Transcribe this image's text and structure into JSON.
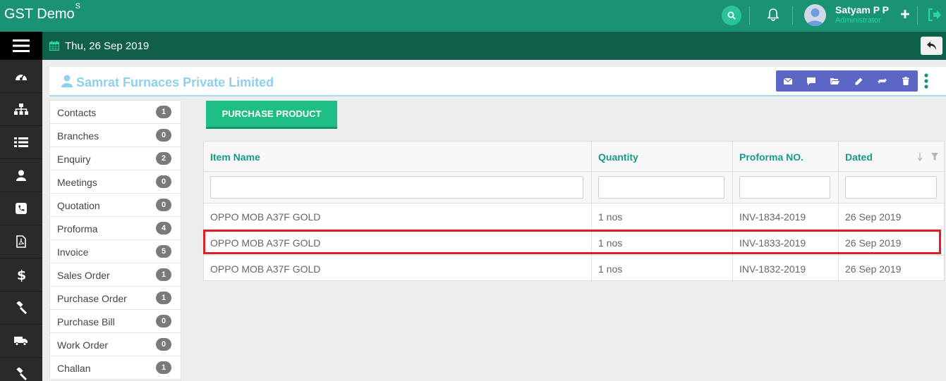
{
  "header": {
    "brand": "GST Demo",
    "brand_sup": "S",
    "user_name": "Satyam P P",
    "user_role": "Administrator"
  },
  "datebar": {
    "date": "Thu, 26 Sep 2019"
  },
  "leftnav": {
    "icons": [
      "menu-icon",
      "dashboard-icon",
      "sitemap-icon",
      "list-icon",
      "user-icon",
      "phone-icon",
      "pdf-icon",
      "dollar-icon",
      "gavel-icon",
      "truck-icon",
      "gavel-icon"
    ]
  },
  "company": {
    "name": "Samrat Furnaces Private Limited",
    "actions": [
      "email-icon",
      "comment-icon",
      "folder-icon",
      "pencil-icon",
      "refresh-icon",
      "trash-icon"
    ]
  },
  "sidebar": {
    "items": [
      {
        "label": "Contacts",
        "count": "1"
      },
      {
        "label": "Branches",
        "count": "0"
      },
      {
        "label": "Enquiry",
        "count": "2"
      },
      {
        "label": "Meetings",
        "count": "0"
      },
      {
        "label": "Quotation",
        "count": "0"
      },
      {
        "label": "Proforma",
        "count": "4"
      },
      {
        "label": "Invoice",
        "count": "5"
      },
      {
        "label": "Sales Order",
        "count": "1"
      },
      {
        "label": "Purchase Order",
        "count": "1"
      },
      {
        "label": "Purchase Bill",
        "count": "0"
      },
      {
        "label": "Work Order",
        "count": "0"
      },
      {
        "label": "Challan",
        "count": "1"
      }
    ]
  },
  "main": {
    "purchase_button": "PURCHASE PRODUCT",
    "columns": [
      "Item Name",
      "Quantity",
      "Proforma NO.",
      "Dated"
    ],
    "rows": [
      [
        "OPPO MOB A37F GOLD",
        "1 nos",
        "INV-1834-2019",
        "26 Sep 2019"
      ],
      [
        "OPPO MOB A37F GOLD",
        "1 nos",
        "INV-1833-2019",
        "26 Sep 2019"
      ],
      [
        "OPPO MOB A37F GOLD",
        "1 nos",
        "INV-1832-2019",
        "26 Sep 2019"
      ]
    ]
  },
  "colors": {
    "topbar": "#1a9274",
    "datebar": "#0f5f4a",
    "accent": "#1fbe85",
    "highlight": "#e01e26"
  }
}
